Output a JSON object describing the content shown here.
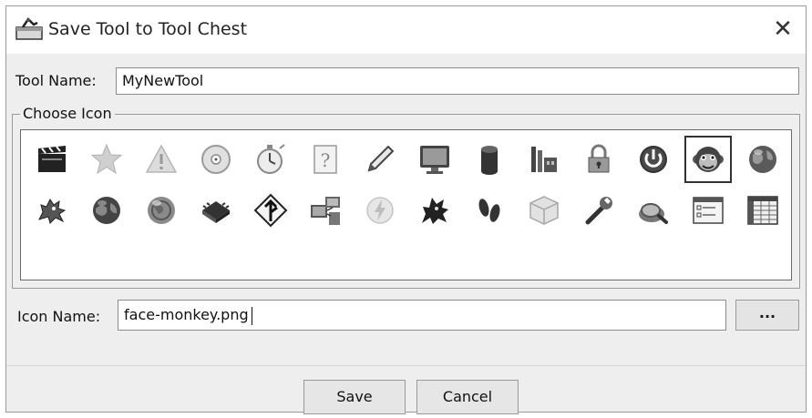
{
  "dialog": {
    "title": "Save Tool to Tool Chest",
    "title_icon": "tool-chest-icon",
    "close_icon": "close-icon",
    "close_glyph": "✕"
  },
  "tool_name": {
    "label": "Tool Name:",
    "value": "MyNewTool"
  },
  "choose_icon": {
    "legend": "Choose Icon",
    "selected": "face-monkey",
    "icons": [
      "clapperboard-icon",
      "star-icon",
      "warning-icon",
      "disc-icon",
      "stopwatch-icon",
      "help-icon",
      "pencil-icon",
      "monitor-icon",
      "cylinder-icon",
      "factory-icon",
      "lock-icon",
      "power-icon",
      "monkey-face-icon",
      "globe-icon",
      "dragon-icon",
      "globe-dark-icon",
      "globe-light-icon",
      "chip-icon",
      "merge-sign-icon",
      "network-icon",
      "lightning-icon",
      "dragon-black-icon",
      "footprints-icon",
      "box-icon",
      "wrench-icon",
      "magnifier-icon",
      "dialog-window-icon",
      "spreadsheet-icon"
    ]
  },
  "icon_name": {
    "label": "Icon Name:",
    "value": "face-monkey.png",
    "browse_label": "..."
  },
  "buttons": {
    "save": "Save",
    "cancel": "Cancel"
  }
}
